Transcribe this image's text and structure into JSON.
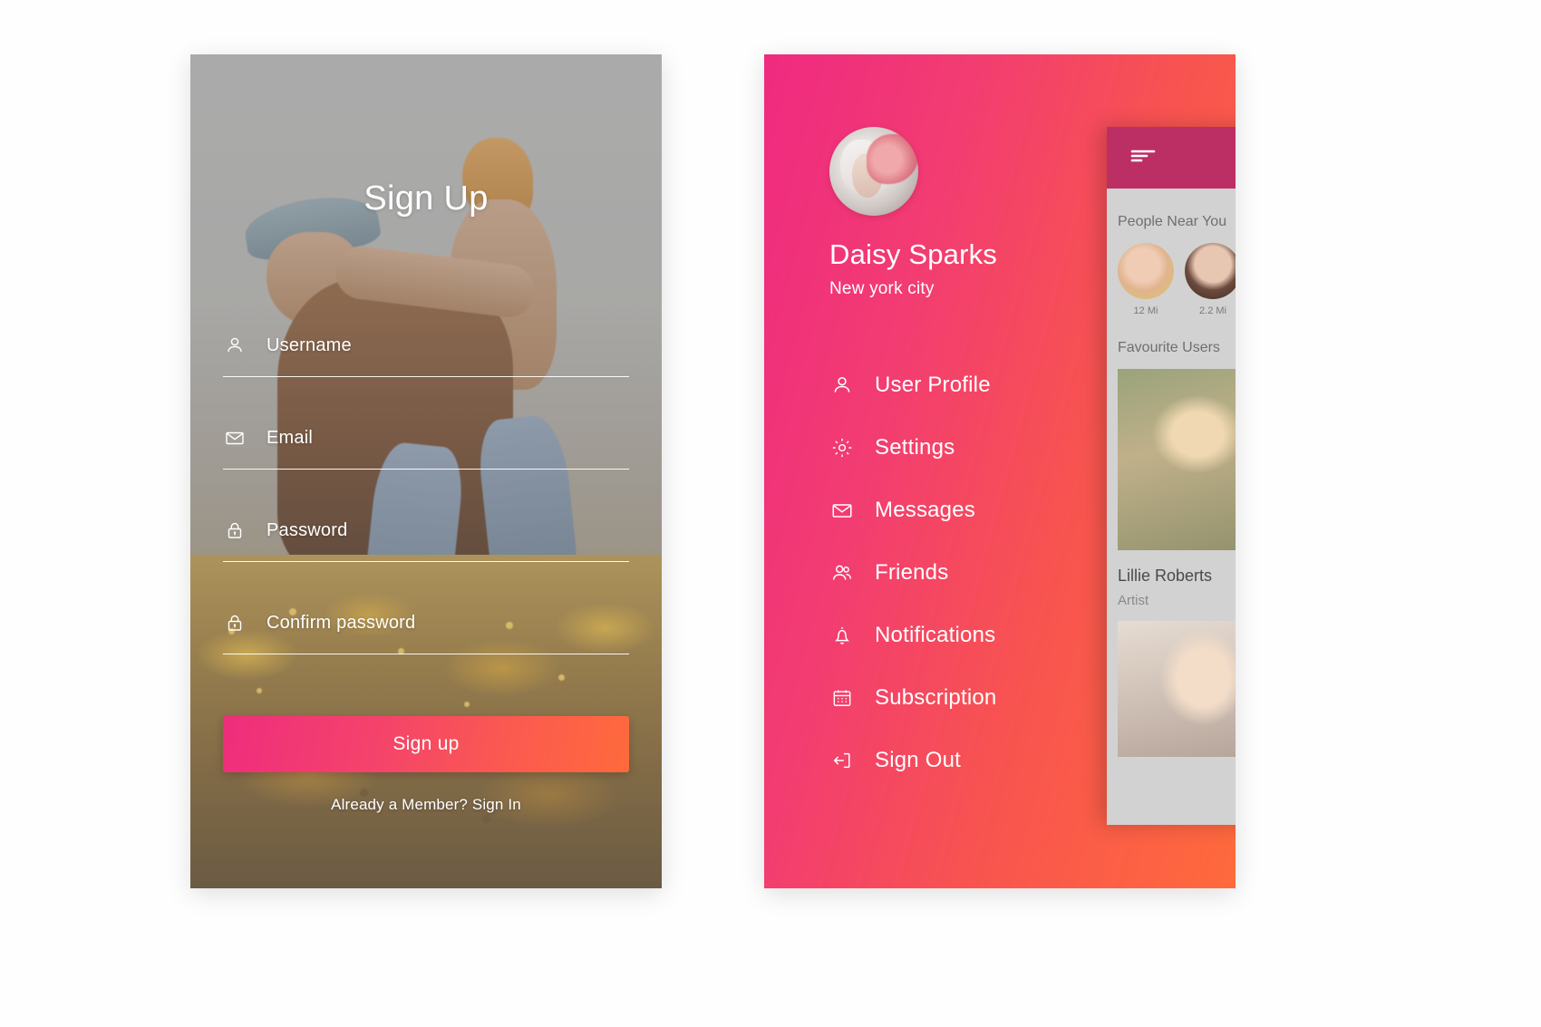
{
  "signup": {
    "title": "Sign Up",
    "fields": [
      {
        "icon": "user-icon",
        "label": "Username"
      },
      {
        "icon": "mail-icon",
        "label": "Email"
      },
      {
        "icon": "lock-icon",
        "label": "Password"
      },
      {
        "icon": "lock-icon",
        "label": "Confirm password"
      }
    ],
    "submit_label": "Sign up",
    "footer_text": "Already a Member? Sign In",
    "accent_start": "#ef2d7c",
    "accent_end": "#ff6a3c"
  },
  "drawer": {
    "profile": {
      "avatar": "user-avatar",
      "name": "Daisy Sparks",
      "location": "New york city"
    },
    "menu": [
      {
        "icon": "user-icon",
        "label": "User Profile"
      },
      {
        "icon": "gear-icon",
        "label": "Settings"
      },
      {
        "icon": "mail-icon",
        "label": "Messages"
      },
      {
        "icon": "friends-icon",
        "label": "Friends"
      },
      {
        "icon": "bell-icon",
        "label": "Notifications"
      },
      {
        "icon": "calendar-icon",
        "label": "Subscription"
      },
      {
        "icon": "sign-out-icon",
        "label": "Sign Out"
      }
    ],
    "gradient_start": "#ef2a80",
    "gradient_end": "#ff6a3c"
  },
  "peek_card": {
    "header_icon": "menu-icon",
    "header_color": "#bc2f64",
    "near_title": "People Near You",
    "near_people": [
      {
        "distance": "12 Mi"
      },
      {
        "distance": "2.2 Mi"
      }
    ],
    "favourite_title": "Favourite Users",
    "favourite": {
      "name": "Lillie Roberts",
      "role": "Artist"
    }
  }
}
